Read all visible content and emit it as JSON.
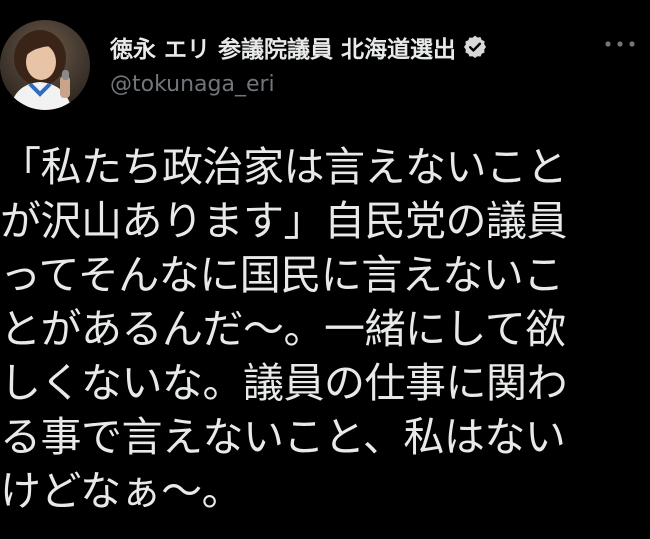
{
  "post": {
    "author": {
      "display_name": "徳永 エリ 参議院議員 北海道選出",
      "handle": "@tokunaga_eri",
      "verified_icon": "verified-badge-icon",
      "avatar": "profile-photo"
    },
    "more_icon": "more-horizontal-icon",
    "text_lines": [
      "「私たち政治家は言えないこと",
      "が沢山あります」自民党の議員",
      "ってそんなに国民に言えないこ",
      "とがあるんだ〜。一緒にして欲",
      "しくないな。議員の仕事に関わ",
      "る事で言えないこと、私はない",
      "けどなぁ〜。"
    ]
  },
  "colors": {
    "background": "#000000",
    "text_primary": "#e7e9ea",
    "text_secondary": "#71767b",
    "badge": "#d9d9d9"
  }
}
